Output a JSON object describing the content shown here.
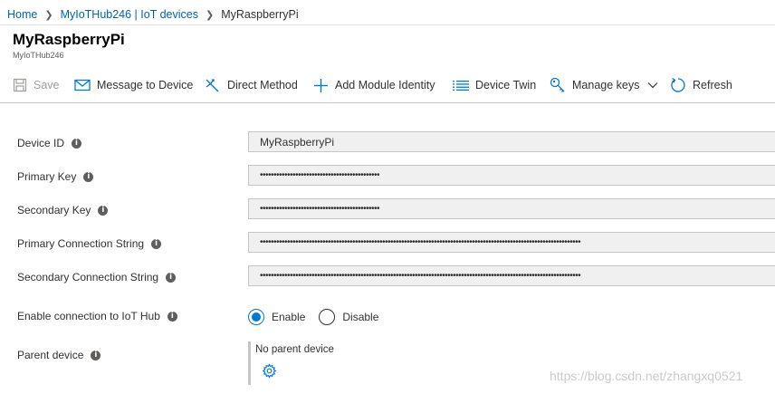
{
  "breadcrumb": {
    "home": "Home",
    "hub": "MyIoTHub246 | IoT devices",
    "current": "MyRaspberryPi"
  },
  "header": {
    "title": "MyRaspberryPi",
    "subtitle": "MyIoTHub246"
  },
  "toolbar": {
    "save": "Save",
    "message": "Message to Device",
    "direct_method": "Direct Method",
    "add_module": "Add Module Identity",
    "device_twin": "Device Twin",
    "manage_keys": "Manage keys",
    "refresh": "Refresh"
  },
  "form": {
    "device_id_label": "Device ID",
    "device_id_value": "MyRaspberryPi",
    "primary_key_label": "Primary Key",
    "primary_key_value": "••••••••••••••••••••••••••••••••••••••••••••",
    "secondary_key_label": "Secondary Key",
    "secondary_key_value": "••••••••••••••••••••••••••••••••••••••••••••",
    "primary_conn_label": "Primary Connection String",
    "primary_conn_value": "••••••••••••••••••••••••••••••••••••••••••••••••••••••••••••••••••••••••••••••••••••••••••••••••••••••••••••••••••••••",
    "secondary_conn_label": "Secondary Connection String",
    "secondary_conn_value": "••••••••••••••••••••••••••••••••••••••••••••••••••••••••••••••••••••••••••••••••••••••••••••••••••••••••••••••••••••••",
    "enable_label": "Enable connection to IoT Hub",
    "enable_option": "Enable",
    "disable_option": "Disable",
    "enable_selected": "Enable",
    "parent_label": "Parent device",
    "parent_value": "No parent device"
  },
  "watermark": "https://blog.csdn.net/zhangxq0521",
  "colors": {
    "accent": "#0078d4",
    "link": "#0063b1",
    "field_bg": "#f0f0f0"
  }
}
